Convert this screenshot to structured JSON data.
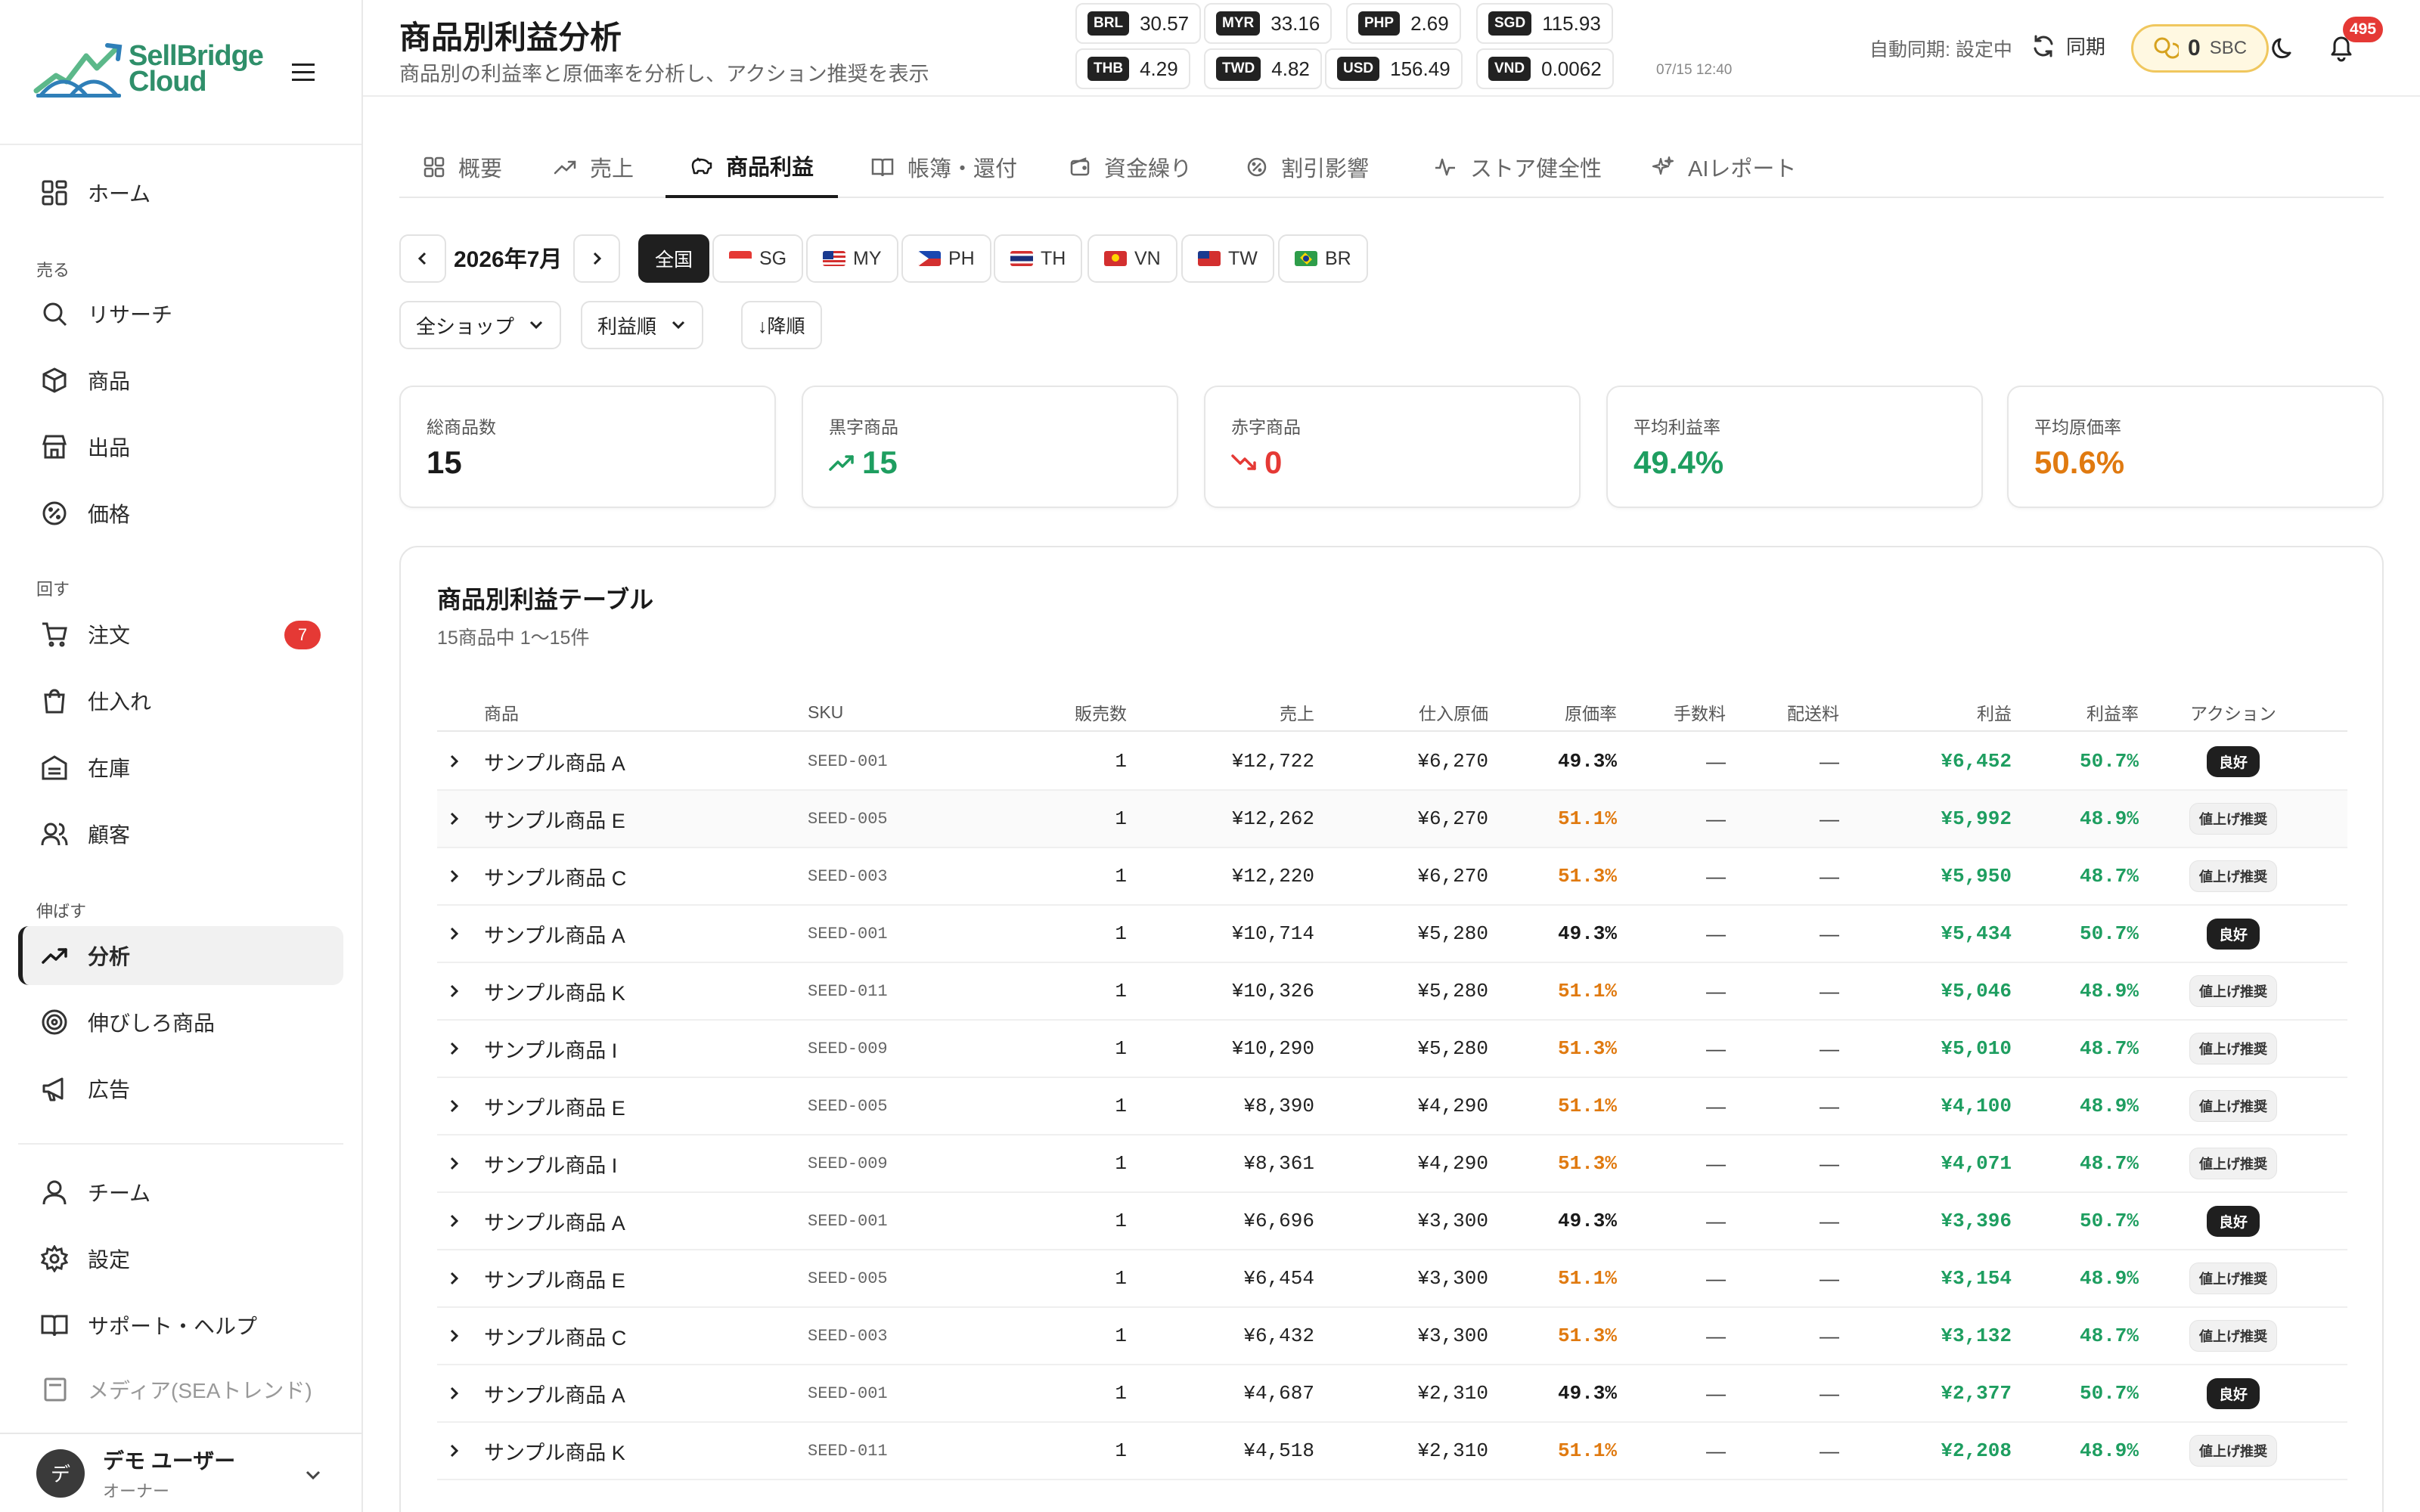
{
  "brand": {
    "line1": "SellBridge",
    "line2": "Cloud"
  },
  "sidebar": {
    "home": "ホーム",
    "sections": {
      "sell": "売る",
      "run": "回す",
      "grow": "伸ばす"
    },
    "items": {
      "research": "リサーチ",
      "products": "商品",
      "listing": "出品",
      "price": "価格",
      "orders": "注文",
      "orders_badge": "7",
      "purchasing": "仕入れ",
      "inventory": "在庫",
      "customers": "顧客",
      "analytics": "分析",
      "growth_products": "伸びしろ商品",
      "ads": "広告",
      "team": "チーム",
      "settings": "設定",
      "support": "サポート・ヘルプ",
      "media_cut": "メディア(SEAトレンド)"
    },
    "user": {
      "initial": "デ",
      "name": "デモ ユーザー",
      "role": "オーナー"
    }
  },
  "header": {
    "title": "商品別利益分析",
    "subtitle": "商品別の利益率と原価率を分析し、アクション推奨を表示",
    "fx": [
      {
        "code": "BRL",
        "value": "30.57"
      },
      {
        "code": "MYR",
        "value": "33.16"
      },
      {
        "code": "PHP",
        "value": "2.69"
      },
      {
        "code": "SGD",
        "value": "115.93"
      },
      {
        "code": "THB",
        "value": "4.29"
      },
      {
        "code": "TWD",
        "value": "4.82"
      },
      {
        "code": "USD",
        "value": "156.49"
      },
      {
        "code": "VND",
        "value": "0.0062"
      }
    ],
    "fx_time": "07/15 12:40",
    "auto_sync": "自動同期: 設定中",
    "sync_label": "同期",
    "sbc_amount": "0",
    "sbc_unit": "SBC",
    "notifications": "495"
  },
  "tabs": [
    {
      "label": "概要",
      "icon": "grid-icon"
    },
    {
      "label": "売上",
      "icon": "trend-icon"
    },
    {
      "label": "商品利益",
      "icon": "piggy-bank-icon",
      "active": true
    },
    {
      "label": "帳簿・還付",
      "icon": "book-icon"
    },
    {
      "label": "資金繰り",
      "icon": "wallet-icon"
    },
    {
      "label": "割引影響",
      "icon": "discount-icon"
    },
    {
      "label": "ストア健全性",
      "icon": "pulse-icon"
    },
    {
      "label": "AIレポート",
      "icon": "sparkle-icon"
    }
  ],
  "filters": {
    "month": "2026年7月",
    "regions": [
      {
        "label": "全国",
        "active": true
      },
      {
        "label": "SG"
      },
      {
        "label": "MY"
      },
      {
        "label": "PH"
      },
      {
        "label": "TH"
      },
      {
        "label": "VN"
      },
      {
        "label": "TW"
      },
      {
        "label": "BR"
      }
    ],
    "shop_select": "全ショップ",
    "sort_select": "利益順",
    "sort_direction": "↓降順"
  },
  "kpis": [
    {
      "label": "総商品数",
      "value": "15",
      "color": "#1a1a1a"
    },
    {
      "label": "黒字商品",
      "value": "15",
      "color": "#1e9e60"
    },
    {
      "label": "赤字商品",
      "value": "0",
      "color": "#e53935"
    },
    {
      "label": "平均利益率",
      "value": "49.4%",
      "color": "#1e9e60"
    },
    {
      "label": "平均原価率",
      "value": "50.6%",
      "color": "#e07a10"
    }
  ],
  "table": {
    "title": "商品別利益テーブル",
    "subtitle": "15商品中 1〜15件",
    "columns": {
      "product": "商品",
      "sku": "SKU",
      "qty": "販売数",
      "sales": "売上",
      "cost": "仕入原価",
      "cost_ratio": "原価率",
      "fee": "手数料",
      "shipping": "配送料",
      "profit": "利益",
      "margin": "利益率",
      "action": "アクション"
    },
    "rows": [
      {
        "name": "サンプル商品 A",
        "sku": "SEED-001",
        "qty": "1",
        "sales": "¥12,722",
        "cost": "¥6,270",
        "ratio": "49.3%",
        "fee": "—",
        "ship": "—",
        "profit": "¥6,452",
        "margin": "50.7%",
        "action": "良好"
      },
      {
        "name": "サンプル商品 E",
        "sku": "SEED-005",
        "qty": "1",
        "sales": "¥12,262",
        "cost": "¥6,270",
        "ratio": "51.1%",
        "fee": "—",
        "ship": "—",
        "profit": "¥5,992",
        "margin": "48.9%",
        "action": "値上げ推奨"
      },
      {
        "name": "サンプル商品 C",
        "sku": "SEED-003",
        "qty": "1",
        "sales": "¥12,220",
        "cost": "¥6,270",
        "ratio": "51.3%",
        "fee": "—",
        "ship": "—",
        "profit": "¥5,950",
        "margin": "48.7%",
        "action": "値上げ推奨"
      },
      {
        "name": "サンプル商品 A",
        "sku": "SEED-001",
        "qty": "1",
        "sales": "¥10,714",
        "cost": "¥5,280",
        "ratio": "49.3%",
        "fee": "—",
        "ship": "—",
        "profit": "¥5,434",
        "margin": "50.7%",
        "action": "良好"
      },
      {
        "name": "サンプル商品 K",
        "sku": "SEED-011",
        "qty": "1",
        "sales": "¥10,326",
        "cost": "¥5,280",
        "ratio": "51.1%",
        "fee": "—",
        "ship": "—",
        "profit": "¥5,046",
        "margin": "48.9%",
        "action": "値上げ推奨"
      },
      {
        "name": "サンプル商品 I",
        "sku": "SEED-009",
        "qty": "1",
        "sales": "¥10,290",
        "cost": "¥5,280",
        "ratio": "51.3%",
        "fee": "—",
        "ship": "—",
        "profit": "¥5,010",
        "margin": "48.7%",
        "action": "値上げ推奨"
      },
      {
        "name": "サンプル商品 E",
        "sku": "SEED-005",
        "qty": "1",
        "sales": "¥8,390",
        "cost": "¥4,290",
        "ratio": "51.1%",
        "fee": "—",
        "ship": "—",
        "profit": "¥4,100",
        "margin": "48.9%",
        "action": "値上げ推奨"
      },
      {
        "name": "サンプル商品 I",
        "sku": "SEED-009",
        "qty": "1",
        "sales": "¥8,361",
        "cost": "¥4,290",
        "ratio": "51.3%",
        "fee": "—",
        "ship": "—",
        "profit": "¥4,071",
        "margin": "48.7%",
        "action": "値上げ推奨"
      },
      {
        "name": "サンプル商品 A",
        "sku": "SEED-001",
        "qty": "1",
        "sales": "¥6,696",
        "cost": "¥3,300",
        "ratio": "49.3%",
        "fee": "—",
        "ship": "—",
        "profit": "¥3,396",
        "margin": "50.7%",
        "action": "良好"
      },
      {
        "name": "サンプル商品 E",
        "sku": "SEED-005",
        "qty": "1",
        "sales": "¥6,454",
        "cost": "¥3,300",
        "ratio": "51.1%",
        "fee": "—",
        "ship": "—",
        "profit": "¥3,154",
        "margin": "48.9%",
        "action": "値上げ推奨"
      },
      {
        "name": "サンプル商品 C",
        "sku": "SEED-003",
        "qty": "1",
        "sales": "¥6,432",
        "cost": "¥3,300",
        "ratio": "51.3%",
        "fee": "—",
        "ship": "—",
        "profit": "¥3,132",
        "margin": "48.7%",
        "action": "値上げ推奨"
      },
      {
        "name": "サンプル商品 A",
        "sku": "SEED-001",
        "qty": "1",
        "sales": "¥4,687",
        "cost": "¥2,310",
        "ratio": "49.3%",
        "fee": "—",
        "ship": "—",
        "profit": "¥2,377",
        "margin": "50.7%",
        "action": "良好"
      },
      {
        "name": "サンプル商品 K",
        "sku": "SEED-011",
        "qty": "1",
        "sales": "¥4,518",
        "cost": "¥2,310",
        "ratio": "51.1%",
        "fee": "—",
        "ship": "—",
        "profit": "¥2,208",
        "margin": "48.9%",
        "action": "値上げ推奨"
      }
    ]
  }
}
